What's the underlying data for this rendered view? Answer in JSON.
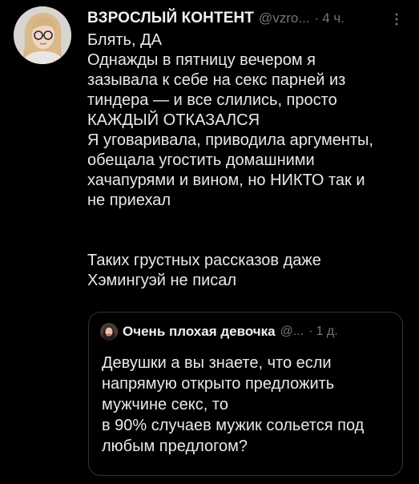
{
  "tweet": {
    "author_name": "ВЗРОСЛЫЙ КОНТЕНТ",
    "handle": "@vzro...",
    "separator": "·",
    "time": "4 ч.",
    "more_icon": "more-vertical-icon",
    "text_lines_1": [
      "Блять, ДА",
      "Однажды в пятницу вечером я",
      "зазывала к себе на секс парней из",
      "тиндера — и все слились, просто",
      "КАЖДЫЙ ОТКАЗАЛСЯ",
      "Я уговаривала, приводила аргументы,",
      "обещала угостить домашними",
      "хачапурями и вином, но НИКТО так и",
      "не приехал"
    ],
    "text_lines_2": [
      "Таких грустных рассказов даже",
      "Хэмингуэй не писал"
    ]
  },
  "quote": {
    "author_name": "Очень плохая девочка",
    "handle": "@...",
    "separator": "·",
    "time": "1 д.",
    "text_lines": [
      "Девушки а вы знаете, что если",
      "напрямую открыто предложить",
      "мужчине секс, то",
      "в 90% случаев мужик сольется под",
      "любым предлогом?"
    ]
  },
  "colors": {
    "background": "#000000",
    "text": "#e7e9ea",
    "muted": "#71767b",
    "border": "#2f3336"
  }
}
